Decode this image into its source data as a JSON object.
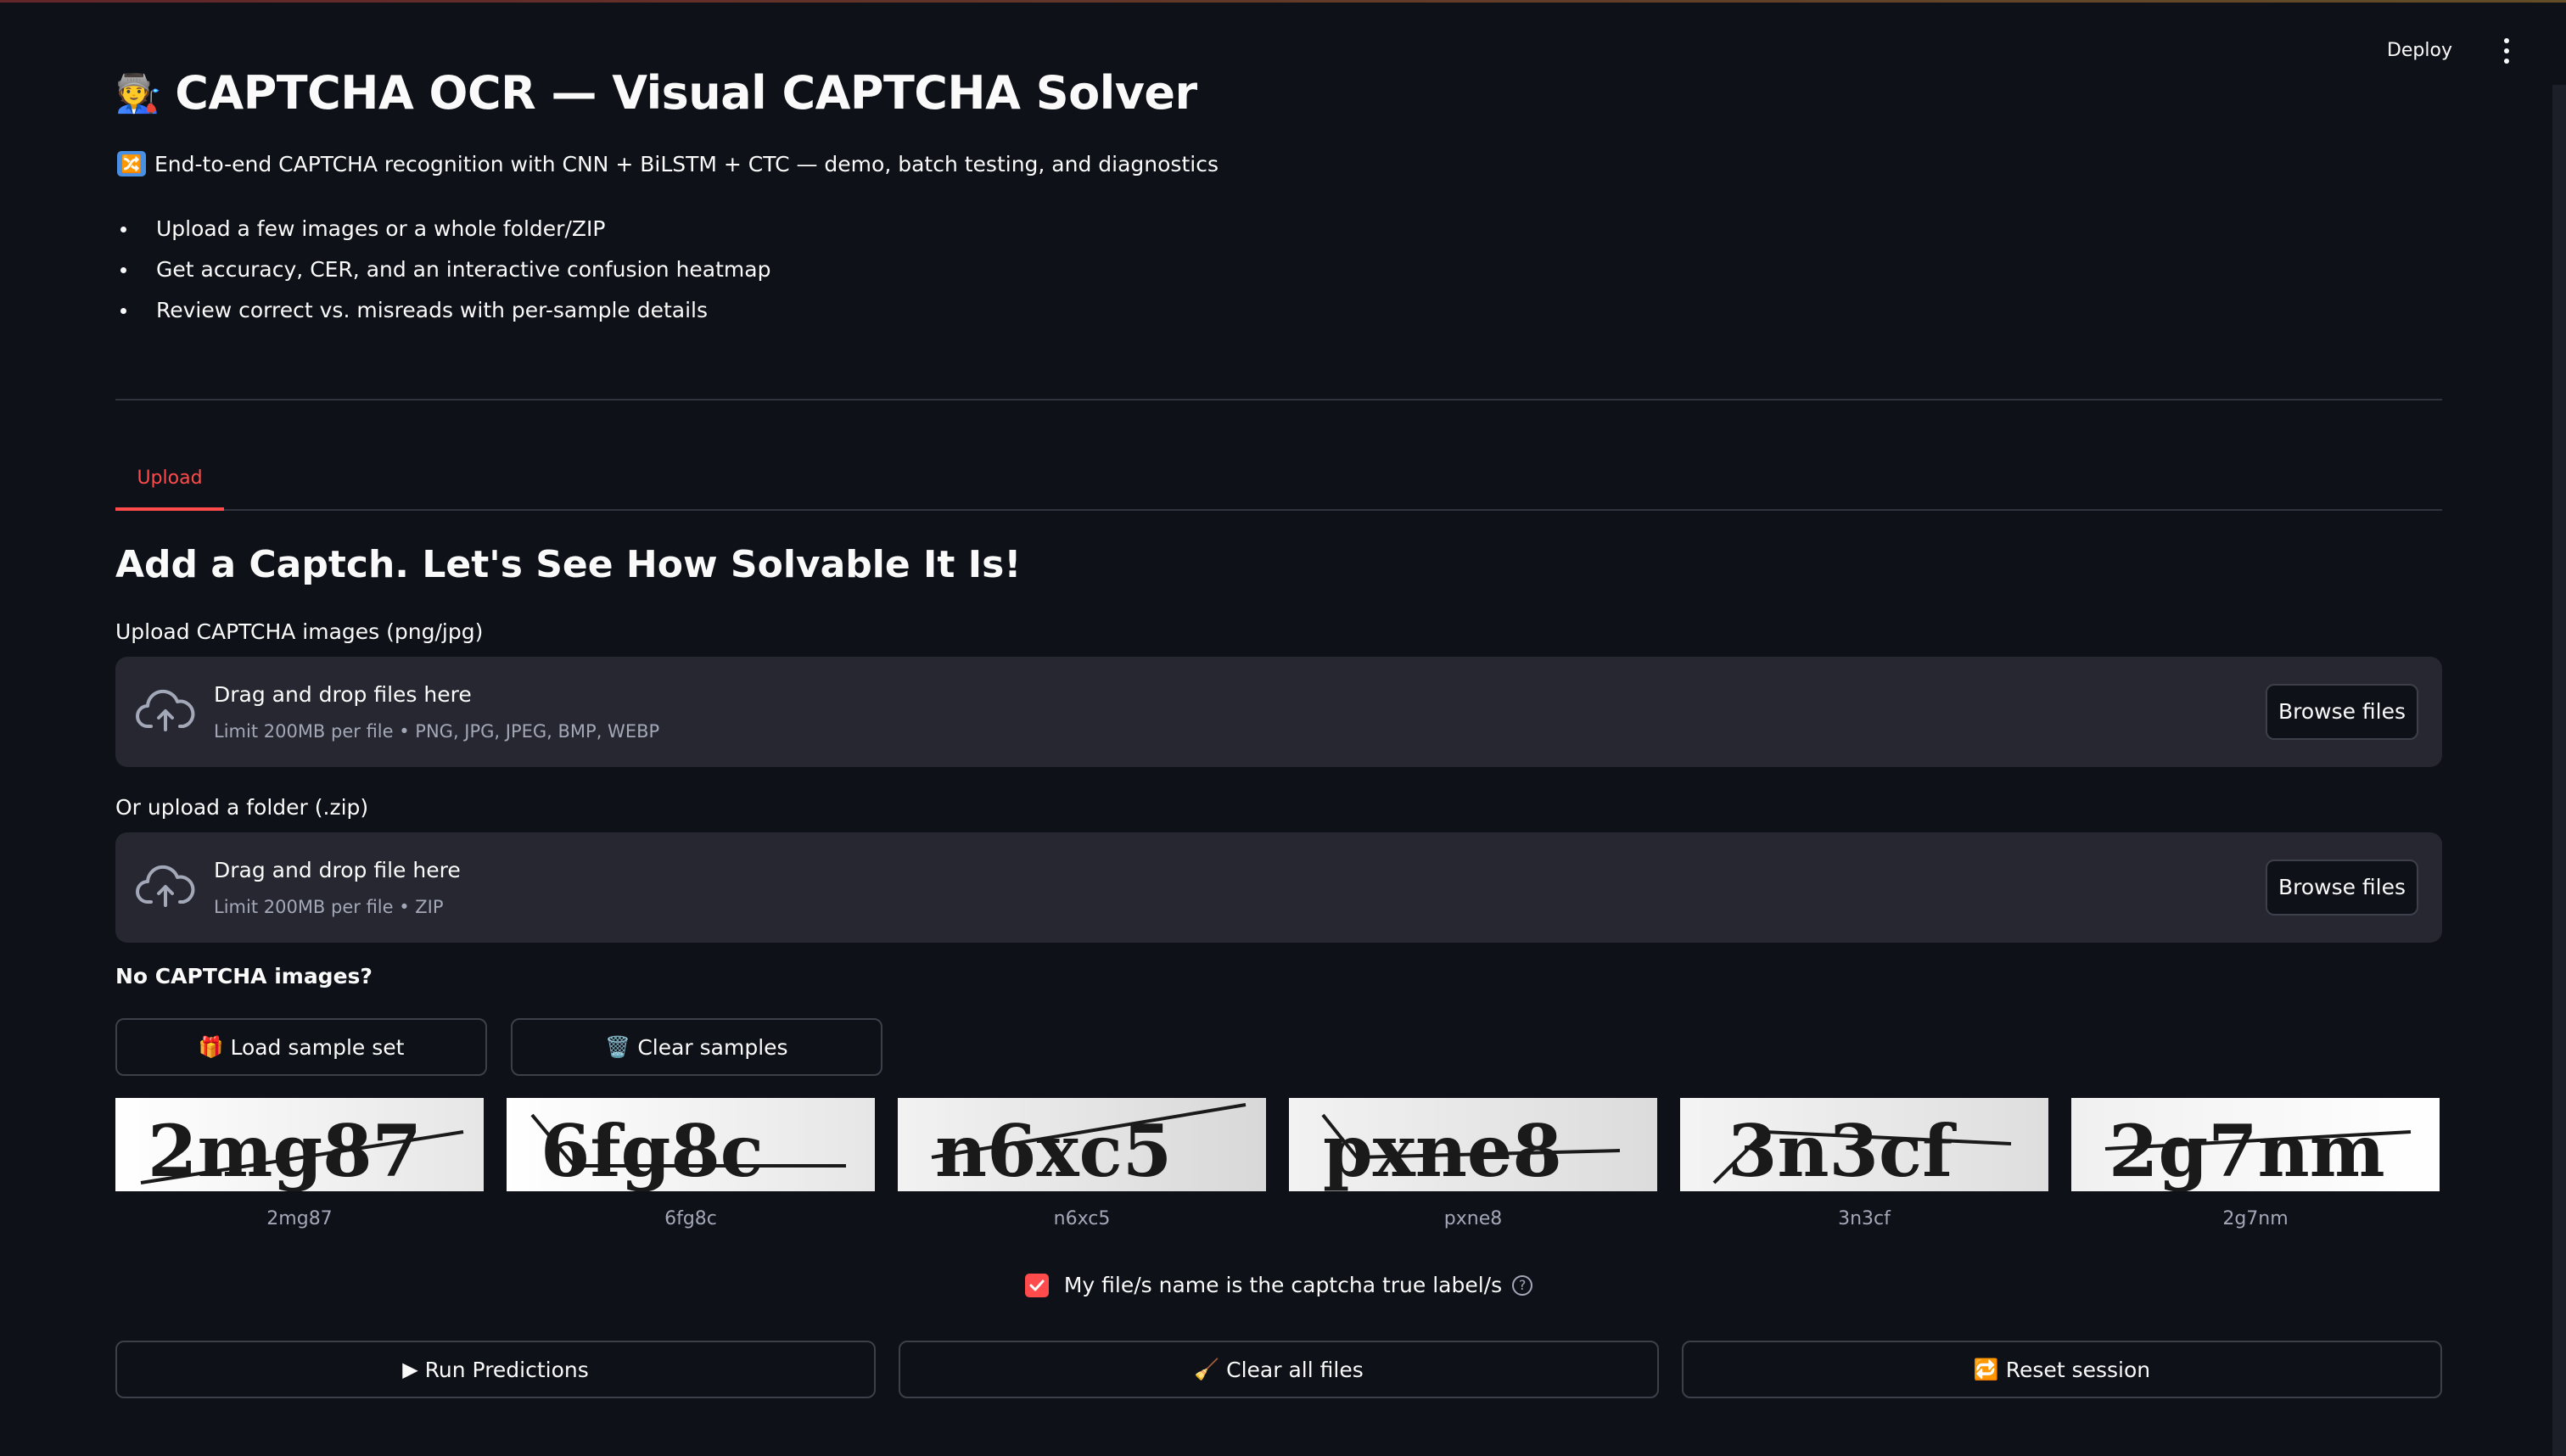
{
  "header": {
    "deploy_label": "Deploy"
  },
  "page": {
    "title_emoji": "🧑‍🏭",
    "title": "CAPTCHA OCR — Visual CAPTCHA Solver",
    "subtitle_icon": "🔀",
    "subtitle": "End-to-end CAPTCHA recognition with CNN + BiLSTM + CTC — demo, batch testing, and diagnostics",
    "bullets": [
      "Upload a few images or a whole folder/ZIP",
      "Get accuracy, CER, and an interactive confusion heatmap",
      "Review correct vs. misreads with per-sample details"
    ]
  },
  "tabs": [
    {
      "label": "Upload",
      "active": true
    }
  ],
  "upload": {
    "heading": "Add a Captch. Let's See How Solvable It Is!",
    "images": {
      "label": "Upload CAPTCHA images (png/jpg)",
      "drop_text": "Drag and drop files here",
      "limit_text": "Limit 200MB per file • PNG, JPG, JPEG, BMP, WEBP",
      "browse_label": "Browse files"
    },
    "zip": {
      "label": "Or upload a folder (.zip)",
      "drop_text": "Drag and drop file here",
      "limit_text": "Limit 200MB per file • ZIP",
      "browse_label": "Browse files"
    },
    "no_images_label": "No CAPTCHA images?",
    "load_sample_icon": "🎁",
    "load_sample_label": "Load sample set",
    "clear_samples_icon": "🗑️",
    "clear_samples_label": "Clear samples",
    "samples": [
      {
        "name": "2mg87",
        "text": "2mg87"
      },
      {
        "name": "6fg8c",
        "text": "6fg8c"
      },
      {
        "name": "n6xc5",
        "text": "n6xc5"
      },
      {
        "name": "pxne8",
        "text": "pxne8"
      },
      {
        "name": "3n3cf",
        "text": "3n3cf"
      },
      {
        "name": "2g7nm",
        "text": "2g7nm"
      }
    ],
    "checkbox_label": "My file/s name is the captcha true label/s",
    "checkbox_checked": true,
    "help_symbol": "?"
  },
  "actions": {
    "run_icon": "▶",
    "run_label": "Run Predictions",
    "clear_all_icon": "🧹",
    "clear_all_label": "Clear all files",
    "reset_icon": "🔁",
    "reset_label": "Reset session"
  },
  "colors": {
    "background": "#0e1117",
    "accent": "#ff4b4b",
    "surface": "#262730",
    "muted_text": "#a3a8b8"
  },
  "icons": {
    "upload": "cloud-upload-icon",
    "menu": "vertical-dots-icon",
    "checkbox": "checkmark-icon",
    "help": "question-circle-icon"
  }
}
